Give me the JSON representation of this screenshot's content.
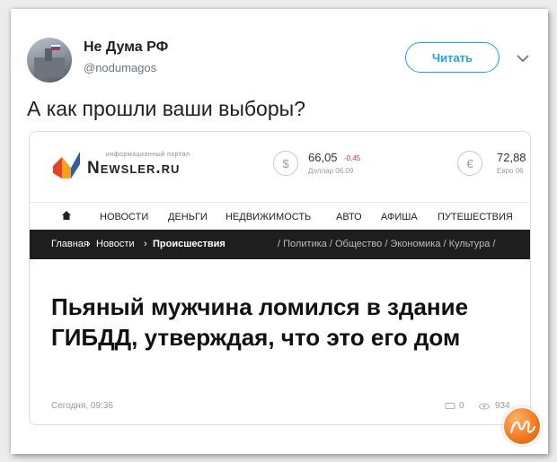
{
  "tweet": {
    "author_name": "Не Дума РФ",
    "author_handle": "@nodumagos",
    "follow_label": "Читать",
    "text": "А как прошли ваши выборы?"
  },
  "site": {
    "portal_tagline": "информационный портал",
    "logo_text": "Newsler.ru",
    "currencies": [
      {
        "symbol": "$",
        "value": "66,05",
        "change": "-0,45",
        "label": "Доллар 06.09"
      },
      {
        "symbol": "€",
        "value": "72,88",
        "label": "Евро 06"
      }
    ],
    "nav": [
      "НОВОСТИ",
      "ДЕНЬГИ",
      "НЕДВИЖИМОСТЬ",
      "АВТО",
      "АФИША",
      "ПУТЕШЕСТВИЯ"
    ],
    "breadcrumb": {
      "home": "Главная",
      "news": "Новости",
      "current": "Происшествия",
      "extra": "/ Политика / Общество / Экономика / Культура /"
    },
    "headline": "Пьяный мужчина ломился в здание ГИБДД, утверждая, что это его дом",
    "date": "Сегодня, 09:36",
    "comments": "0",
    "views": "934"
  },
  "colors": {
    "accent": "#1da1f2",
    "breadcrumb_bg": "#1e1e1e",
    "badge": "#f47b20"
  },
  "icons": [
    "chevron-down-icon",
    "home-icon",
    "comment-icon",
    "eye-icon",
    "newsler-logo-icon",
    "watermark-badge"
  ]
}
